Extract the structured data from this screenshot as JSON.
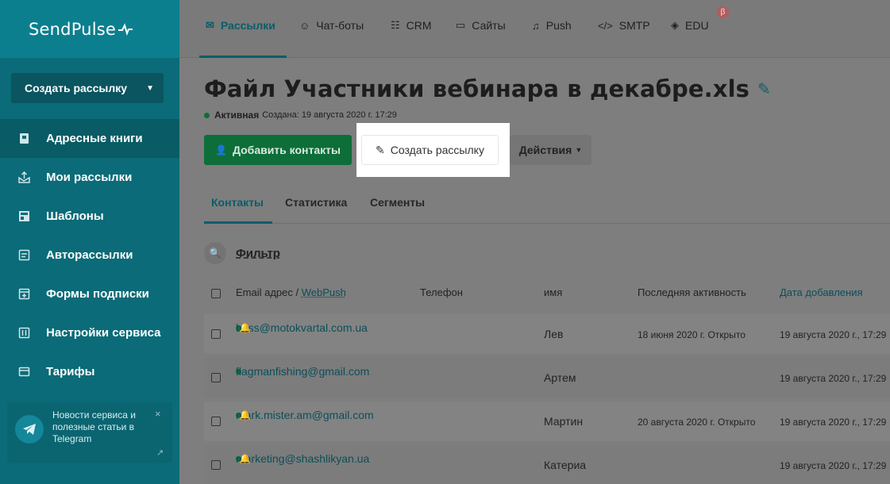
{
  "brand": {
    "name": "SendPulse"
  },
  "sidebar": {
    "create_button": "Создать рассылку",
    "items": [
      {
        "label": "Адресные книги",
        "icon": "address-book-icon",
        "active": true
      },
      {
        "label": "Мои рассылки",
        "icon": "campaigns-icon"
      },
      {
        "label": "Шаблоны",
        "icon": "templates-icon"
      },
      {
        "label": "Авторассылки",
        "icon": "automation-icon"
      },
      {
        "label": "Формы подписки",
        "icon": "forms-icon"
      },
      {
        "label": "Настройки сервиса",
        "icon": "settings-icon"
      },
      {
        "label": "Тарифы",
        "icon": "pricing-icon"
      }
    ],
    "telegram": {
      "text": "Новости сервиса и полезные статьи в Telegram",
      "close": "×",
      "external": "↗"
    }
  },
  "topnav": {
    "items": [
      {
        "label": "Рассылки",
        "icon": "mail-icon",
        "active": true
      },
      {
        "label": "Чат-боты",
        "icon": "chat-icon"
      },
      {
        "label": "CRM",
        "icon": "crm-icon"
      },
      {
        "label": "Сайты",
        "icon": "sites-icon"
      },
      {
        "label": "Push",
        "icon": "bell-icon"
      },
      {
        "label": "SMTP",
        "icon": "code-icon"
      },
      {
        "label": "EDU",
        "icon": "graduation-icon"
      }
    ],
    "beta_badge": "β"
  },
  "page": {
    "title": "Файл Участники вебинара в декабре.xls",
    "status": "Активная",
    "created": "Создана: 19 августа 2020 г. 17:29"
  },
  "actions": {
    "add_contacts": "Добавить контакты",
    "create_campaign": "Создать рассылку",
    "actions": "Действия"
  },
  "tabs": [
    "Контакты",
    "Статистика",
    "Сегменты"
  ],
  "filter": {
    "label": "Фильтр"
  },
  "table": {
    "headers": {
      "email": "Email адрес / ",
      "webpush": "WebPush",
      "phone": "Телефон",
      "name": "имя",
      "last_activity": "Последняя активность",
      "date_added": "Дата добавления"
    },
    "rows": [
      {
        "email": "boss@motokvartal.com.ua",
        "push": true,
        "name": "Лев",
        "last_activity": "18 июня 2020 г. Открыто",
        "date_added": "19 августа 2020 г., 17:29"
      },
      {
        "email": "flagmanfishing@gmail.com",
        "push": false,
        "name": "Артем",
        "last_activity": "",
        "date_added": "19 августа 2020 г., 17:29"
      },
      {
        "email": "mark.mister.am@gmail.com",
        "push": true,
        "name": "Мартин",
        "last_activity": "20 августа 2020 г. Открыто",
        "date_added": "19 августа 2020 г., 17:29"
      },
      {
        "email": "marketing@shashlikyan.ua",
        "push": true,
        "name": "Катериа",
        "last_activity": "",
        "date_added": "19 августа 2020 г., 17:29"
      }
    ]
  },
  "colors": {
    "sidebar": "#0b6b78",
    "accent": "#0a5d69",
    "green": "#0d6e3a"
  }
}
